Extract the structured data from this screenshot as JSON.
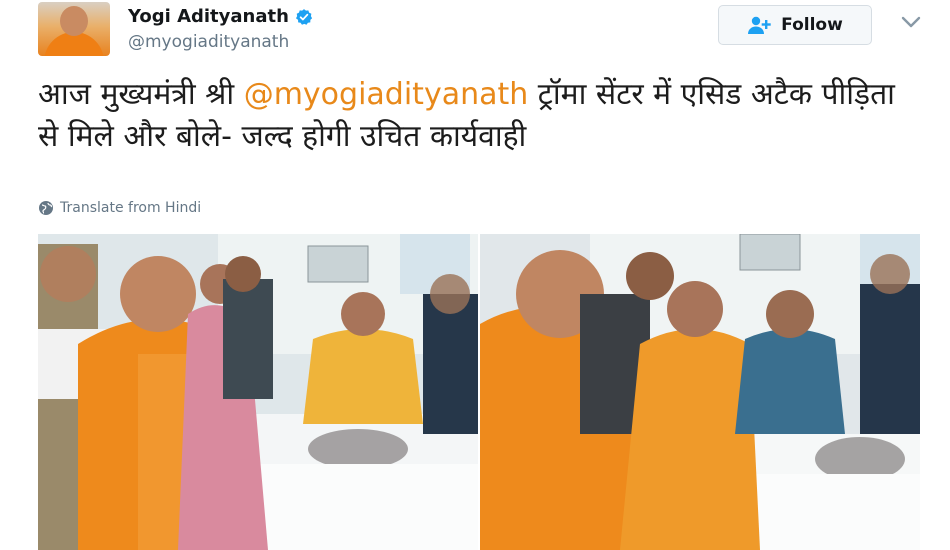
{
  "author": {
    "display_name": "Yogi Adityanath",
    "handle": "@myogiadityanath",
    "verified": true,
    "avatar_icon": "profile-avatar"
  },
  "follow_button": {
    "label": "Follow",
    "icon": "add-user-icon",
    "color": "#1da1f2"
  },
  "tweet": {
    "text_before": "आज मुख्यमंत्री श्री ",
    "mention": "@myogiadityanath",
    "text_after": " ट्रॉमा सेंटर में एसिड अटैक पीड़िता से मिले और बोले- जल्द होगी उचित कार्यवाही",
    "mention_color": "#e8891a"
  },
  "translate": {
    "label": "Translate from Hindi",
    "icon": "globe-icon"
  },
  "media": {
    "photos": [
      {
        "description_icon": "hospital-visit-photo-left"
      },
      {
        "description_icon": "hospital-visit-photo-right"
      }
    ]
  }
}
